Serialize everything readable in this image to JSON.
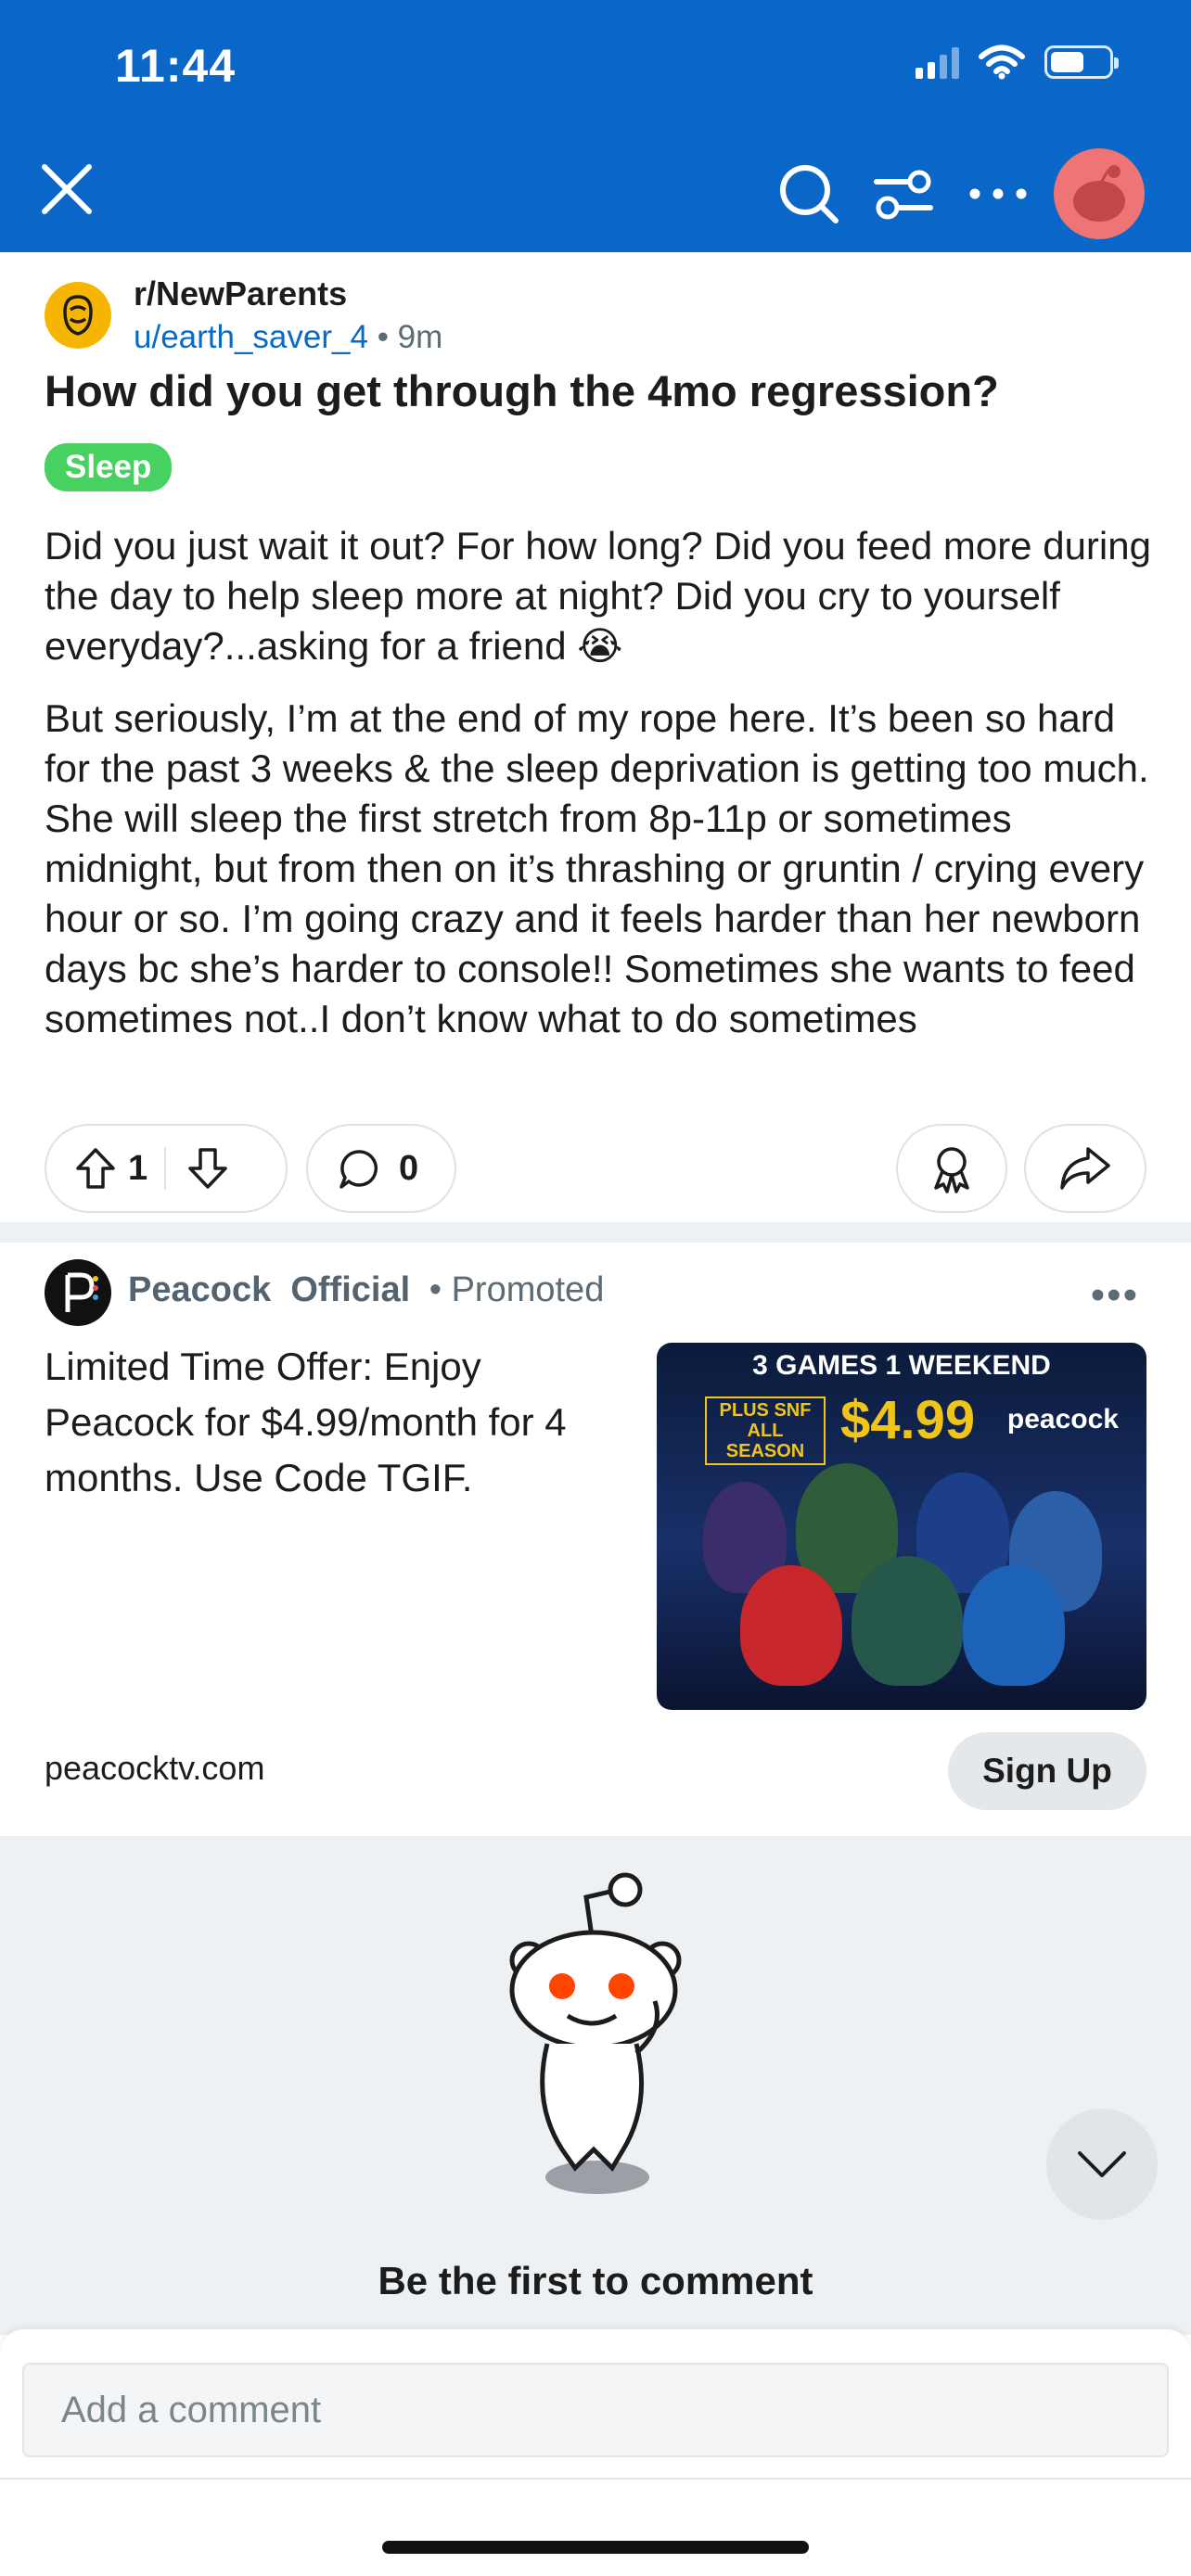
{
  "status_bar": {
    "time": "11:44"
  },
  "colors": {
    "header": "#0a67c8",
    "flair": "#46d160",
    "link": "#0b6ac4"
  },
  "nav": {
    "close_icon": "close-icon",
    "search_icon": "search-icon",
    "filter_icon": "sort-filter-icon",
    "more_icon": "more-icon",
    "avatar": "avatar"
  },
  "post": {
    "subreddit": "r/NewParents",
    "author": "u/earth_saver_4",
    "age": "• 9m",
    "title": "How did you get through the 4mo regression?",
    "flair": "Sleep",
    "body_p1": "Did you just wait it out? For how long? Did you feed more during the day to help sleep more at night? Did you cry to yourself everyday?...asking for a friend 😭",
    "body_p2": "But seriously, I’m at the end of my rope here. It’s been so hard for the past 3 weeks & the sleep deprivation is getting too much. She will sleep the first stretch from 8p-11p or sometimes midnight, but from then on it’s thrashing or gruntin / crying every hour or so. I’m going crazy and it feels harder than her newborn days bc she’s harder to console!! Sometimes she wants to feed sometimes not..I don’t know what to do sometimes",
    "upvotes": "1",
    "comments": "0"
  },
  "ad": {
    "advertiser": "Peacock  Official",
    "promoted": "• Promoted",
    "more": "•••",
    "text": "Limited Time Offer: Enjoy Peacock for $4.99/month for 4 months. Use Code TGIF.",
    "image_title": "3 GAMES 1 WEEKEND",
    "image_offer": "PLUS SNF ALL SEASON",
    "image_price": "$4.99",
    "image_brand": "peacock",
    "domain": "peacocktv.com",
    "cta": "Sign Up"
  },
  "comments_section": {
    "empty_text": "Be the first to comment",
    "input_placeholder": "Add a comment"
  }
}
